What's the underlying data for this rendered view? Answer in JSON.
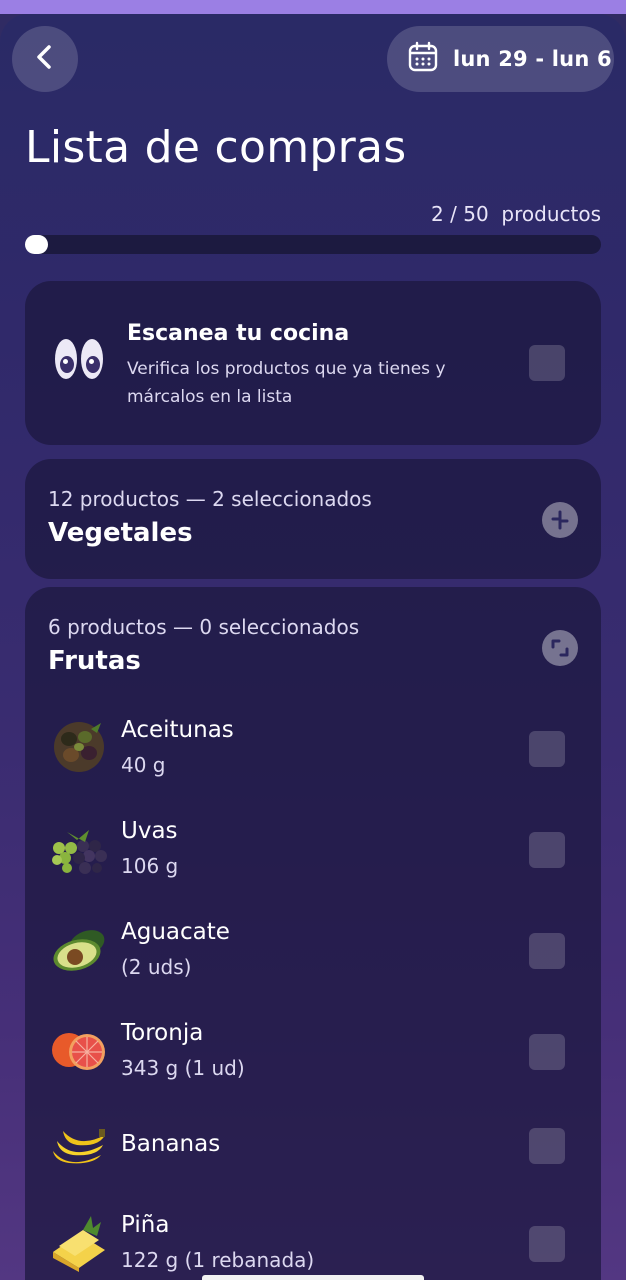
{
  "header": {
    "back_icon": "chevron-left-icon",
    "calendar_icon": "calendar-icon",
    "date_range": "lun 29 - lun 6"
  },
  "title": "Lista de compras",
  "progress": {
    "selected": "2",
    "total": "50",
    "count_text": "2 / 50",
    "unit": "productos",
    "fraction": 0.04
  },
  "scan_card": {
    "icon": "eyes-icon",
    "title": "Escanea tu cocina",
    "description": "Verifica los productos que ya tienes y márcalos en la lista"
  },
  "categories": [
    {
      "meta": "12 productos — 2 seleccionados",
      "name": "Vegetales",
      "toggle_icon": "collapse-icon"
    },
    {
      "meta": "6 productos — 0 seleccionados",
      "name": "Frutas",
      "toggle_icon": "expand-icon",
      "items": [
        {
          "name": "Aceitunas",
          "qty": "40 g",
          "icon": "olives-icon"
        },
        {
          "name": "Uvas",
          "qty": "106 g",
          "icon": "grapes-icon"
        },
        {
          "name": "Aguacate",
          "qty": "(2 uds)",
          "icon": "avocado-icon"
        },
        {
          "name": "Toronja",
          "qty": "343 g  (1 ud)",
          "icon": "grapefruit-icon"
        },
        {
          "name": "Bananas",
          "qty": "",
          "icon": "banana-icon"
        },
        {
          "name": "Piña",
          "qty": "122 g  (1 rebanada)",
          "icon": "pineapple-icon"
        }
      ]
    }
  ],
  "colors": {
    "background": "#2e2a62",
    "card": "#1c183e",
    "accent_top": "#9b7fe4"
  }
}
